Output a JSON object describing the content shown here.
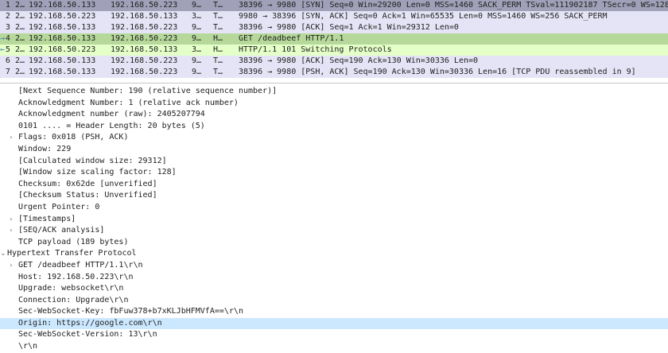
{
  "packet_list": {
    "rows": [
      {
        "no": "1 2…",
        "src": "192.168.50.133",
        "dst": "192.168.50.223",
        "len": "9…",
        "proto": "T…",
        "info": "38396 → 9980 [SYN] Seq=0 Win=29200 Len=0 MSS=1460 SACK_PERM TSval=111902187 TSecr=0 WS=128",
        "style": "tcp-dark",
        "mark": ""
      },
      {
        "no": "2 2…",
        "src": "192.168.50.223",
        "dst": "192.168.50.133",
        "len": "3…",
        "proto": "T…",
        "info": "9980 → 38396 [SYN, ACK] Seq=0 Ack=1 Win=65535 Len=0 MSS=1460 WS=256 SACK_PERM",
        "style": "tcp",
        "mark": ""
      },
      {
        "no": "3 2…",
        "src": "192.168.50.133",
        "dst": "192.168.50.223",
        "len": "9…",
        "proto": "T…",
        "info": "38396 → 9980 [ACK] Seq=1 Ack=1 Win=29312 Len=0",
        "style": "tcp",
        "mark": ""
      },
      {
        "no": "4 2…",
        "src": "192.168.50.133",
        "dst": "192.168.50.223",
        "len": "9…",
        "proto": "H…",
        "info": "GET /deadbeef HTTP/1.1",
        "style": "http-dark",
        "mark": "→"
      },
      {
        "no": "5 2…",
        "src": "192.168.50.223",
        "dst": "192.168.50.133",
        "len": "3…",
        "proto": "H…",
        "info": "HTTP/1.1 101 Switching Protocols",
        "style": "http",
        "mark": "←"
      },
      {
        "no": "6 2…",
        "src": "192.168.50.133",
        "dst": "192.168.50.223",
        "len": "9…",
        "proto": "T…",
        "info": "38396 → 9980 [ACK] Seq=190 Ack=130 Win=30336 Len=0",
        "style": "tcp",
        "mark": ""
      },
      {
        "no": "7 2…",
        "src": "192.168.50.133",
        "dst": "192.168.50.223",
        "len": "9…",
        "proto": "T…",
        "info": "38396 → 9980 [PSH, ACK] Seq=190 Ack=130 Win=30336 Len=16 [TCP PDU reassembled in 9]",
        "style": "tcp",
        "mark": ""
      }
    ]
  },
  "details": {
    "rows": [
      {
        "level": 1,
        "expander": "",
        "text": "[Next Sequence Number: 190    (relative sequence number)]"
      },
      {
        "level": 1,
        "expander": "",
        "text": "Acknowledgment Number: 1    (relative ack number)"
      },
      {
        "level": 1,
        "expander": "",
        "text": "Acknowledgment number (raw): 2405207794"
      },
      {
        "level": 1,
        "expander": "",
        "text": "0101 .... = Header Length: 20 bytes (5)"
      },
      {
        "level": 1,
        "expander": "›",
        "text": "Flags: 0x018 (PSH, ACK)"
      },
      {
        "level": 1,
        "expander": "",
        "text": "Window: 229"
      },
      {
        "level": 1,
        "expander": "",
        "text": "[Calculated window size: 29312]"
      },
      {
        "level": 1,
        "expander": "",
        "text": "[Window size scaling factor: 128]"
      },
      {
        "level": 1,
        "expander": "",
        "text": "Checksum: 0x62de [unverified]"
      },
      {
        "level": 1,
        "expander": "",
        "text": "[Checksum Status: Unverified]"
      },
      {
        "level": 1,
        "expander": "",
        "text": "Urgent Pointer: 0"
      },
      {
        "level": 1,
        "expander": "›",
        "text": "[Timestamps]"
      },
      {
        "level": 1,
        "expander": "›",
        "text": "[SEQ/ACK analysis]"
      },
      {
        "level": 1,
        "expander": "",
        "text": "TCP payload (189 bytes)"
      },
      {
        "level": 0,
        "expander": "⌄",
        "text": "Hypertext Transfer Protocol"
      },
      {
        "level": 1,
        "expander": "›",
        "text": "GET /deadbeef HTTP/1.1\\r\\n"
      },
      {
        "level": 1,
        "expander": "",
        "text": "Host: 192.168.50.223\\r\\n"
      },
      {
        "level": 1,
        "expander": "",
        "text": "Upgrade: websocket\\r\\n"
      },
      {
        "level": 1,
        "expander": "",
        "text": "Connection: Upgrade\\r\\n"
      },
      {
        "level": 1,
        "expander": "",
        "text": "Sec-WebSocket-Key: fbFuw378+b7xKLJbHFMVfA==\\r\\n"
      },
      {
        "level": 1,
        "expander": "",
        "text": "Origin: https://google.com\\r\\n",
        "selected": true
      },
      {
        "level": 1,
        "expander": "",
        "text": "Sec-WebSocket-Version: 13\\r\\n"
      },
      {
        "level": 1,
        "expander": "",
        "text": "\\r\\n"
      }
    ]
  },
  "colors": {
    "tcp": "#e4e4f6",
    "http": "#e4ffc7",
    "selection": "#cce8ff"
  }
}
